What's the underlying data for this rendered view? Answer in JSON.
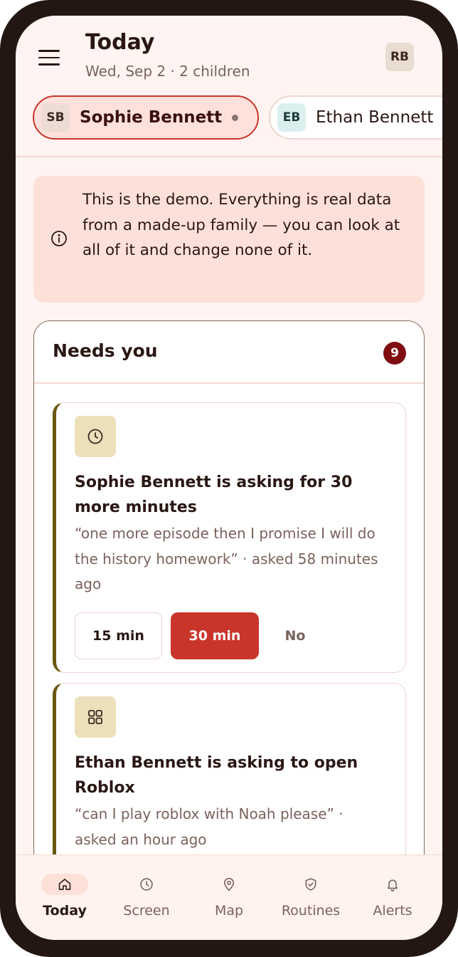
{
  "header": {
    "title": "Today",
    "subtitle": "Wed, Sep 2 · 2 children",
    "user_initials": "RB"
  },
  "children": [
    {
      "initials": "SB",
      "name": "Sophie Bennett",
      "selected": true
    },
    {
      "initials": "EB",
      "name": "Ethan Bennett",
      "selected": false
    }
  ],
  "banner": {
    "icon": "info-icon",
    "text": "This is the demo. Everything is real data from a made-up family — you can look at all of it and change none of it."
  },
  "needs_you": {
    "title": "Needs you",
    "count": "9",
    "requests": [
      {
        "icon": "clock-icon",
        "title": "Sophie Bennett is asking for 30 more minutes",
        "quote": "“one more episode then I promise I will do the history homework” · asked 58 minutes ago",
        "actions": {
          "opt1": "15 min",
          "opt2": "30 min",
          "deny": "No"
        }
      },
      {
        "icon": "apps-grid-icon",
        "title": "Ethan Bennett is asking to open Roblox",
        "quote": "“can I play roblox with Noah please” · asked an hour ago"
      }
    ]
  },
  "nav": [
    {
      "label": "Today",
      "icon": "home-icon",
      "active": true
    },
    {
      "label": "Screen",
      "icon": "clock-icon"
    },
    {
      "label": "Map",
      "icon": "map-pin-icon"
    },
    {
      "label": "Routines",
      "icon": "shield-check-icon"
    },
    {
      "label": "Alerts",
      "icon": "bell-icon"
    }
  ],
  "colors": {
    "accent": "#c9352b",
    "badge": "#7f0d12",
    "background": "#fff4f1",
    "request_stripe": "#6a5810"
  }
}
